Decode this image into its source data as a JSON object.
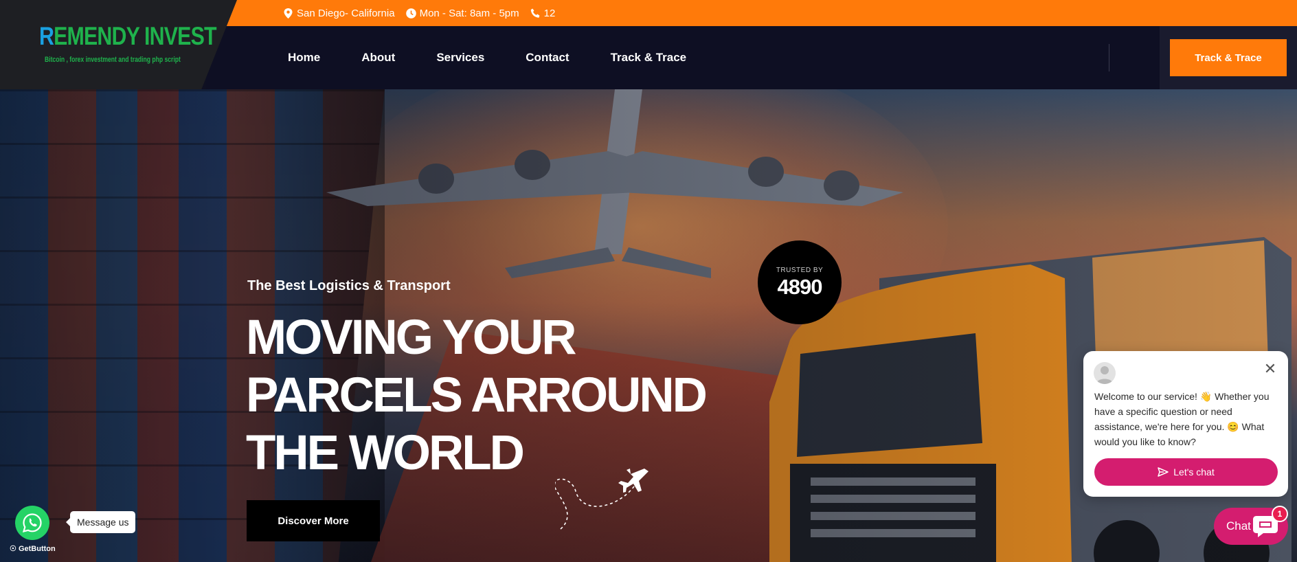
{
  "brand": {
    "name_first": "R",
    "name_rest": "EMENDY INVEST",
    "tagline": "Bitcoin , forex investment and trading php script"
  },
  "topbar": {
    "location": "San Diego- California",
    "hours": "Mon - Sat: 8am - 5pm",
    "phone": "12"
  },
  "nav": {
    "items": [
      "Home",
      "About",
      "Services",
      "Contact",
      "Track & Trace"
    ],
    "cta_label": "Track & Trace"
  },
  "hero": {
    "tagline": "The Best Logistics & Transport",
    "headline": [
      "MOVING YOUR",
      "PARCELS ARROUND",
      "THE WORLD"
    ],
    "button_label": "Discover More",
    "trusted_label": "TRUSTED BY",
    "trusted_count": "4890"
  },
  "whatsapp": {
    "label": "Message us",
    "credit": "GetButton"
  },
  "chat": {
    "message": "Welcome to our service! 👋 Whether you have a specific question or need assistance, we're here for you. 😊 What would you like to know?",
    "button_label": "Let's chat",
    "launcher_label": "Chat",
    "badge_count": "1"
  },
  "colors": {
    "accent": "#ff7a0a",
    "navy": "#0e0f23",
    "brand_green": "#1fb24c",
    "chat_pink": "#d41d6f",
    "whatsapp_green": "#25d366"
  }
}
